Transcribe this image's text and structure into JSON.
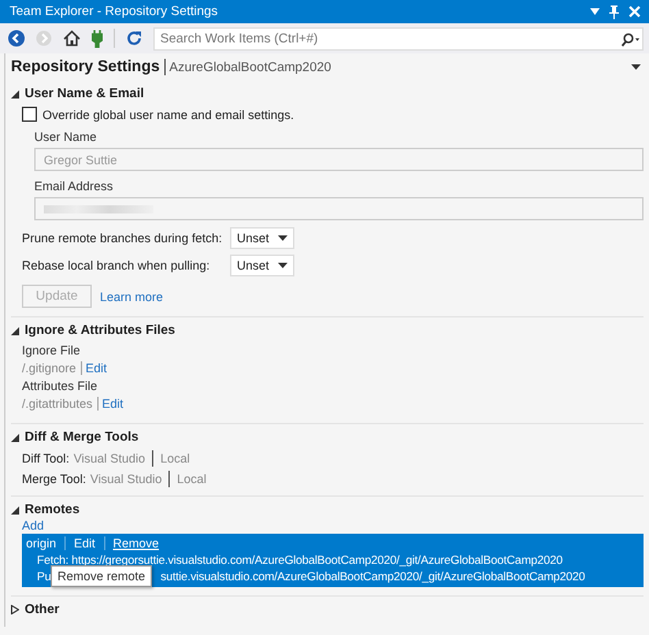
{
  "window": {
    "title": "Team Explorer - Repository Settings"
  },
  "toolbar": {
    "search": {
      "placeholder": "Search Work Items (Ctrl+#)"
    }
  },
  "page_header": {
    "title": "Repository Settings",
    "repository": "AzureGlobalBootCamp2020"
  },
  "user_section": {
    "title": "User Name & Email",
    "expanded": true,
    "override": {
      "label": "Override global user name and email settings.",
      "checked": false
    },
    "user_name": {
      "label": "User Name",
      "value": "Gregor Suttie",
      "disabled": true
    },
    "email": {
      "label": "Email Address",
      "disabled": true
    },
    "options": [
      {
        "label": "Prune remote branches during fetch:",
        "value": "Unset"
      },
      {
        "label": "Rebase local branch when pulling:",
        "value": "Unset"
      }
    ],
    "update_button": {
      "label": "Update",
      "disabled": true
    },
    "learn_more": "Learn more"
  },
  "files_section": {
    "title": "Ignore & Attributes Files",
    "expanded": true,
    "files": [
      {
        "label": "Ignore File",
        "path": "/.gitignore",
        "action": "Edit"
      },
      {
        "label": "Attributes File",
        "path": "/.gitattributes",
        "action": "Edit"
      }
    ]
  },
  "tools_section": {
    "title": "Diff & Merge Tools",
    "expanded": true,
    "tools": [
      {
        "label": "Diff Tool:",
        "value": "Visual Studio",
        "scope": "Local"
      },
      {
        "label": "Merge Tool:",
        "value": "Visual Studio",
        "scope": "Local"
      }
    ]
  },
  "remotes_section": {
    "title": "Remotes",
    "expanded": true,
    "add": "Add",
    "remotes": [
      {
        "name": "origin",
        "edit": "Edit",
        "remove": "Remove",
        "selected": true,
        "fetch": "Fetch: https://gregorsuttie.visualstudio.com/AzureGlobalBootCamp2020/_git/AzureGlobalBootCamp2020",
        "push_start": "Pu",
        "push_rest": "suttie.visualstudio.com/AzureGlobalBootCamp2020/_git/AzureGlobalBootCamp2020"
      }
    ]
  },
  "tooltip": {
    "text": "Remove remote"
  },
  "other_section": {
    "title": "Other",
    "expanded": false
  }
}
